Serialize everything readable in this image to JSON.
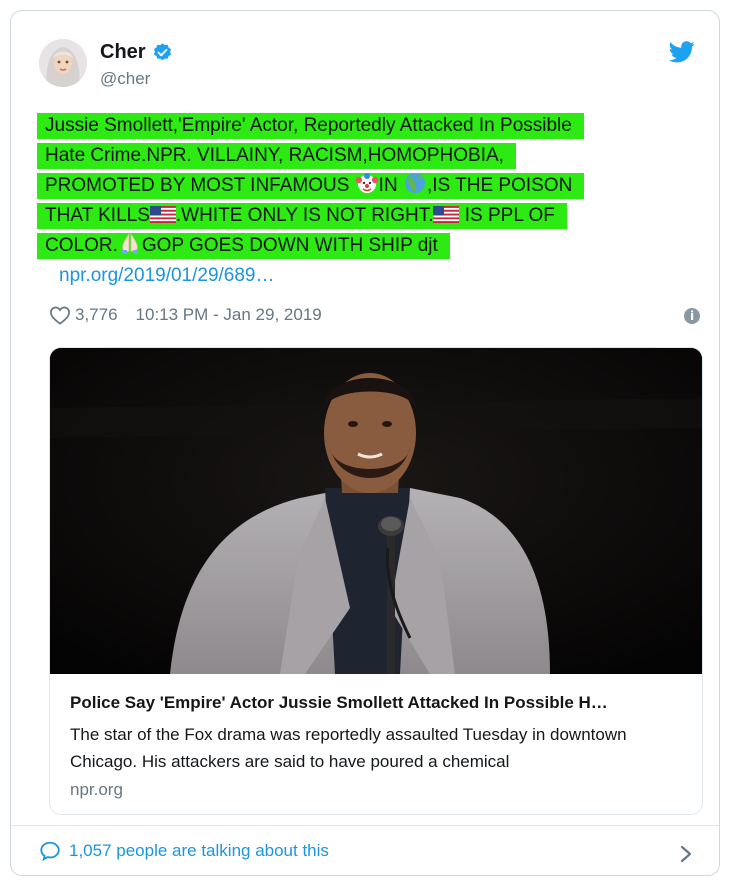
{
  "tweet": {
    "author_name": "Cher",
    "author_handle": "@cher",
    "text_segments": {
      "l1": "Jussie Smollett,'Empire' Actor, Reportedly Attacked In Possible",
      "l2": "Hate Crime.NPR. VILLAINY, RACISM,HOMOPHOBIA,",
      "l3a": "PROMOTED BY MOST INFAMOUS ",
      "l3b": "IN ",
      "l3c": ",IS THE POISON",
      "l4a": "THAT KILLS",
      "l4b": ".WHITE ONLY IS NOT RIGHT.",
      "l4c": " IS PPL OF",
      "l5a": "COLOR.",
      "l5b": "GOP GOES DOWN WITH SHIP djt"
    },
    "link_text": "npr.org/2019/01/29/689…",
    "like_count": "3,776",
    "timestamp": "10:13 PM - Jan 29, 2019"
  },
  "link_card": {
    "title": "Police Say 'Empire' Actor Jussie Smollett Attacked In Possible H…",
    "description": "The star of the Fox drama was reportedly assaulted Tuesday in downtown Chicago. His attackers are said to have poured a chemical",
    "domain": "npr.org"
  },
  "footer": {
    "talking_text": "1,057 people are talking about this"
  },
  "icons": {
    "verified": "verified-badge-icon",
    "twitter": "twitter-bird-icon",
    "like": "heart-icon",
    "info": "info-icon",
    "reply": "speech-bubble-icon",
    "chevron": "chevron-right-icon",
    "emojis": [
      "clown-face-emoji",
      "globe-americas-emoji",
      "us-flag-emoji",
      "folded-hands-emoji"
    ]
  },
  "colors": {
    "highlight": "#2cea12",
    "link": "#1b95e0",
    "secondary_text": "#657786",
    "twitter_blue": "#1da1f2"
  }
}
